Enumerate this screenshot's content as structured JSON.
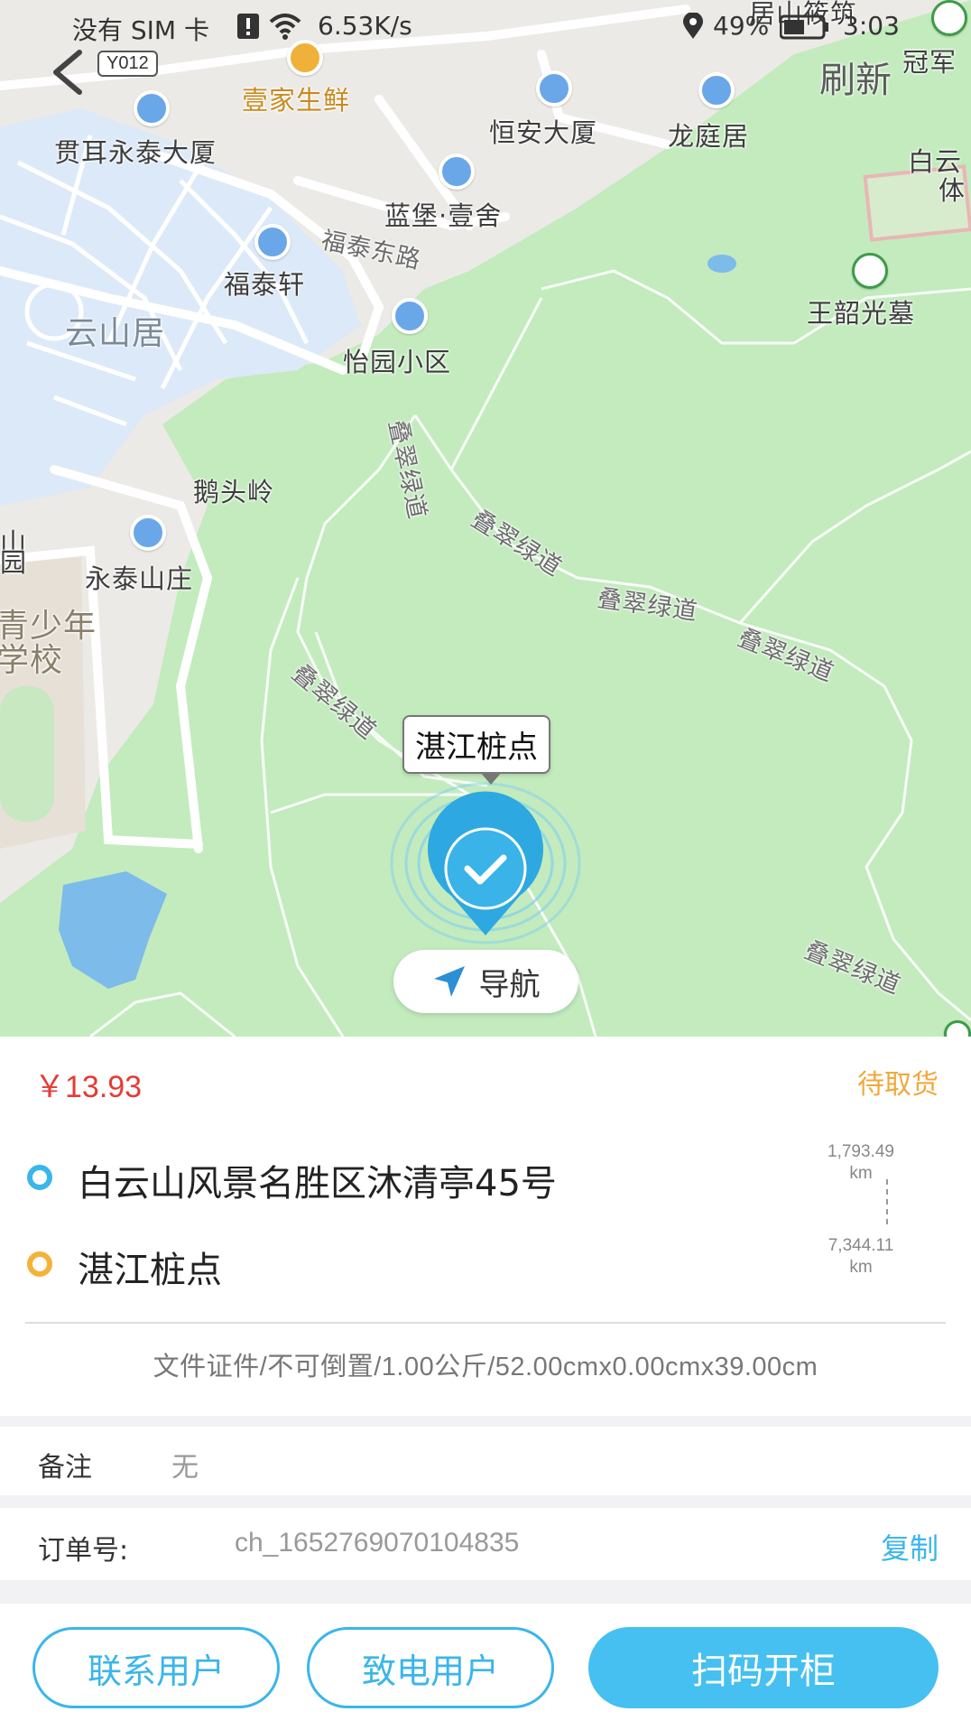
{
  "status_bar": {
    "carrier": "没有 SIM 卡",
    "speed": "6.53K/s",
    "battery": "49%",
    "time": "3:03"
  },
  "map": {
    "road_badge": "Y012",
    "refresh": "刷新",
    "labels": {
      "yijia": "壹家生鲜",
      "guaner": "贯耳永泰大厦",
      "hengan": "恒安大厦",
      "longting": "龙庭居",
      "lanbao": "蓝堡·壹舍",
      "futai_road": "福泰东路",
      "futaixuan": "福泰轩",
      "yunshanju": "云山居",
      "yiyuan": "怡园小区",
      "etouling": "鹅头岭",
      "yongtai": "永泰山庄",
      "school_a": "青少年",
      "school_b": "学校",
      "wangshao": "王韶光墓",
      "baiyun_a": "白云",
      "baiyun_b": "体",
      "guanjun": "冠军",
      "top_edge": "居山筱筑",
      "green_path_1": "叠翠绿道",
      "green_path_2": "叠翠绿道",
      "green_path_3": "叠翠绿道",
      "green_path_4": "叠翠绿道",
      "green_path_5": "叠翠绿道",
      "green_path_6": "叠翠绿道",
      "left_edge_a": "山",
      "left_edge_b": "园"
    },
    "marker_callout": "湛江桩点",
    "nav_button": "导航"
  },
  "order": {
    "price": "￥13.93",
    "status": "待取货",
    "from_address": "白云山风景名胜区沐清亭45号",
    "to_address": "湛江桩点",
    "from_distance_value": "1,793.49",
    "from_distance_unit": "km",
    "to_distance_value": "7,344.11",
    "to_distance_unit": "km",
    "package_info": "文件证件/不可倒置/1.00公斤/52.00cmx0.00cmx39.00cm",
    "remark_label": "备注",
    "remark_value": "无",
    "order_no_label": "订单号:",
    "order_no_value": "ch_1652769070104835",
    "copy_label": "复制"
  },
  "actions": {
    "contact_user": "联系用户",
    "call_user": "致电用户",
    "scan_open": "扫码开柜"
  },
  "colors": {
    "accent": "#3ab6ea",
    "price": "#e53b35",
    "status": "#f0a93a",
    "park_green": "#c3ebbe",
    "residential_blue": "#dce9f8"
  }
}
